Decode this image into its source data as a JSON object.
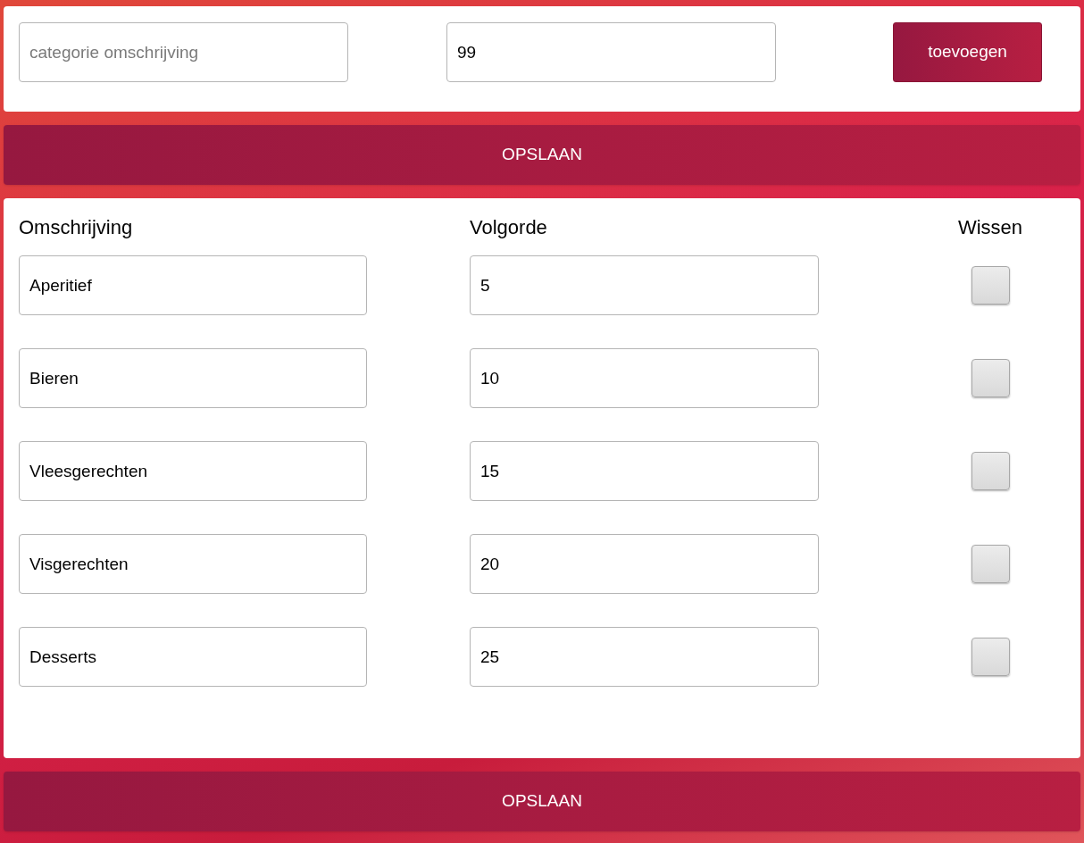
{
  "new_category": {
    "description_placeholder": "categorie omschrijving",
    "order_value": "99",
    "add_button": "toevoegen"
  },
  "save_buttons": [
    "OPSLAAN",
    "OPSLAAN"
  ],
  "table": {
    "columns": [
      "Omschrijving",
      "Volgorde",
      "Wissen"
    ],
    "rows": [
      {
        "description": "Aperitief",
        "order": "5",
        "delete": false
      },
      {
        "description": "Bieren",
        "order": "10",
        "delete": false
      },
      {
        "description": "Vleesgerechten",
        "order": "15",
        "delete": false
      },
      {
        "description": "Visgerechten",
        "order": "20",
        "delete": false
      },
      {
        "description": "Desserts",
        "order": "25",
        "delete": false
      }
    ]
  }
}
